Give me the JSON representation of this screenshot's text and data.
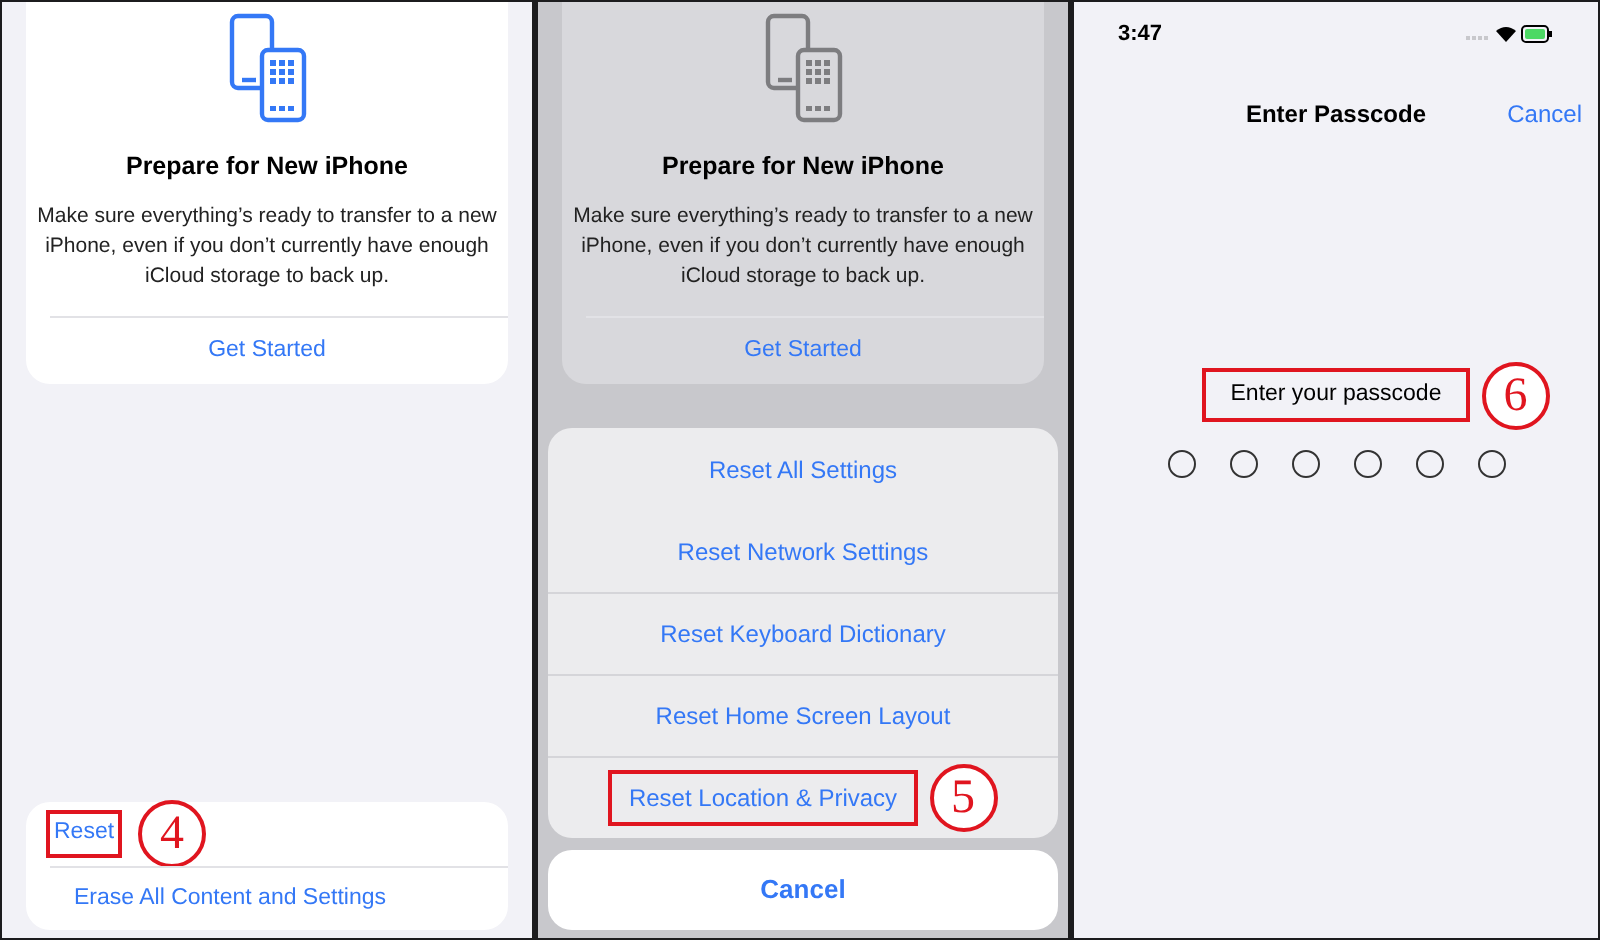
{
  "transfer_screen": {
    "card": {
      "title": "Prepare for New iPhone",
      "description": "Make sure everything’s ready to transfer to a new iPhone, even if you don’t currently have enough iCloud storage to back up.",
      "action": "Get Started"
    },
    "reset_items": [
      {
        "label": "Reset",
        "highlighted": true,
        "step": "4"
      },
      {
        "label": "Erase All Content and Settings",
        "highlighted": false
      }
    ]
  },
  "reset_sheet": {
    "card": {
      "title": "Prepare for New iPhone",
      "description": "Make sure everything’s ready to transfer to a new iPhone, even if you don’t currently have enough iCloud storage to back up.",
      "action": "Get Started"
    },
    "options": [
      {
        "label": "Reset All Settings",
        "highlighted": false
      },
      {
        "label": "Reset Network Settings",
        "highlighted": false
      },
      {
        "label": "Reset Keyboard Dictionary",
        "highlighted": false
      },
      {
        "label": "Reset Home Screen Layout",
        "highlighted": false
      },
      {
        "label": "Reset Location & Privacy",
        "highlighted": true,
        "step": "5"
      }
    ],
    "cancel": "Cancel"
  },
  "passcode_screen": {
    "status_bar": {
      "time": "3:47"
    },
    "title": "Enter Passcode",
    "cancel": "Cancel",
    "prompt": {
      "text": "Enter your passcode",
      "highlighted": true,
      "step": "6"
    },
    "digits": [
      {
        "filled": false
      },
      {
        "filled": false
      },
      {
        "filled": false
      },
      {
        "filled": false
      },
      {
        "filled": false
      },
      {
        "filled": false
      }
    ]
  }
}
